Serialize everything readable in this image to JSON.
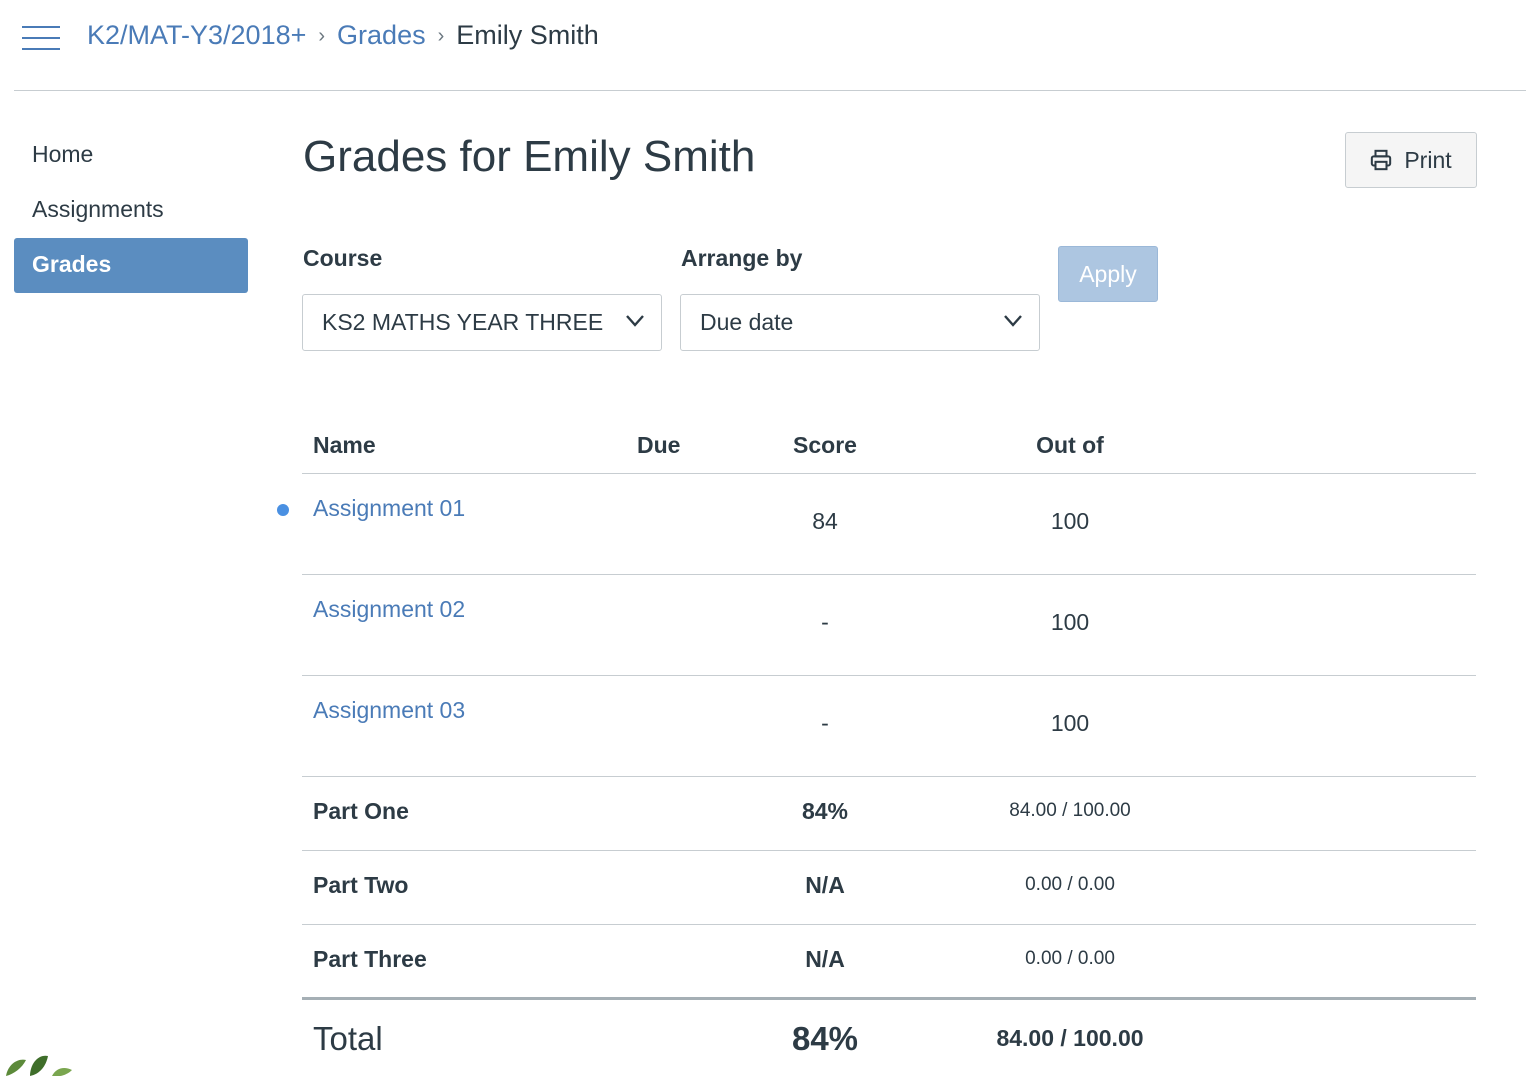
{
  "breadcrumb": {
    "course": "K2/MAT-Y3/2018+",
    "section": "Grades",
    "student": "Emily Smith",
    "separator": "›"
  },
  "sidebar": {
    "items": [
      {
        "label": "Home",
        "active": false
      },
      {
        "label": "Assignments",
        "active": false
      },
      {
        "label": "Grades",
        "active": true
      }
    ]
  },
  "page": {
    "title": "Grades for Emily Smith",
    "print_label": "Print"
  },
  "filters": {
    "course_label": "Course",
    "course_value": "KS2 MATHS YEAR THREE",
    "arrange_label": "Arrange by",
    "arrange_value": "Due date",
    "apply_label": "Apply"
  },
  "table": {
    "headers": {
      "name": "Name",
      "due": "Due",
      "score": "Score",
      "out_of": "Out of"
    },
    "assignments": [
      {
        "name": "Assignment 01",
        "due": "",
        "score": "84",
        "out_of": "100",
        "unread": true
      },
      {
        "name": "Assignment 02",
        "due": "",
        "score": "-",
        "out_of": "100",
        "unread": false
      },
      {
        "name": "Assignment 03",
        "due": "",
        "score": "-",
        "out_of": "100",
        "unread": false
      }
    ],
    "groups": [
      {
        "name": "Part One",
        "score": "84%",
        "fraction": "84.00 / 100.00"
      },
      {
        "name": "Part Two",
        "score": "N/A",
        "fraction": "0.00 / 0.00"
      },
      {
        "name": "Part Three",
        "score": "N/A",
        "fraction": "0.00 / 0.00"
      }
    ],
    "total": {
      "name": "Total",
      "score": "84%",
      "fraction": "84.00 / 100.00"
    }
  },
  "colors": {
    "link": "#4a7bb7",
    "active_nav": "#5b8dc0",
    "apply_disabled": "#adc6e1",
    "unread_dot": "#4a90e2",
    "text": "#2d3b45"
  }
}
